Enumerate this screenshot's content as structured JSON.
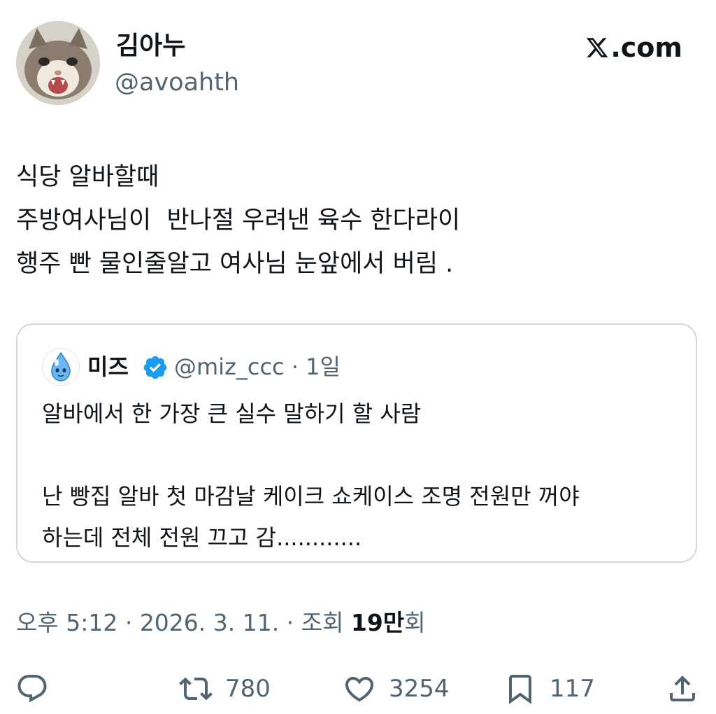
{
  "author": {
    "display_name": "김아누",
    "handle": "@avoahth",
    "avatar_icon": "cat-avatar"
  },
  "brand": {
    "label": ".com",
    "icon": "x-logo-icon"
  },
  "tweet": {
    "lines": [
      "식당 알바할때",
      "주방여사님이  반나절 우려낸 육수 한다라이",
      "행주 빤 물인줄알고 여사님 눈앞에서 버림 ."
    ]
  },
  "quote": {
    "display_name": "미즈",
    "verified_icon": "verified-badge-icon",
    "meta": "@miz_ccc · 1일",
    "lines": [
      "알바에서 한 가장 큰 실수 말하기 할 사람",
      "",
      "난 빵집 알바 첫 마감날 케이크 쇼케이스 조명 전원만 꺼야",
      "하는데 전체 전원 끄고 감............"
    ]
  },
  "meta": {
    "time": "오후 5:12",
    "date": "2026. 3. 11.",
    "views_label": "조회",
    "views_count": "19만",
    "views_suffix": "회"
  },
  "actions": {
    "reply_icon": "reply-icon",
    "retweet_icon": "retweet-icon",
    "retweet_count": "780",
    "like_icon": "heart-icon",
    "like_count": "3254",
    "bookmark_icon": "bookmark-icon",
    "bookmark_count": "117",
    "share_icon": "share-icon"
  },
  "colors": {
    "text": "#0f1419",
    "secondary": "#536471",
    "border": "#cfd9de",
    "verified": "#1d9bf0"
  }
}
